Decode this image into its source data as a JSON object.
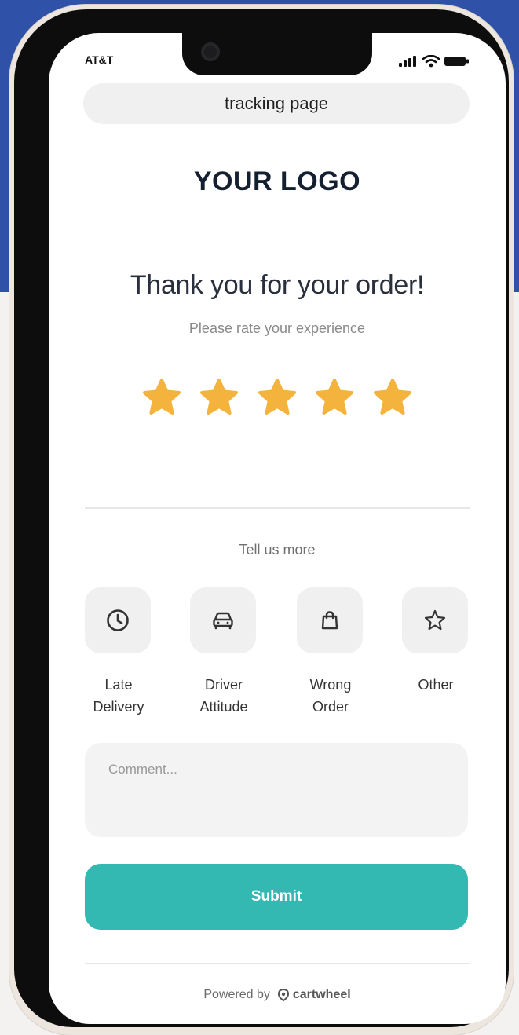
{
  "status_bar": {
    "carrier": "AT&T"
  },
  "browser": {
    "url_label": "tracking page"
  },
  "page": {
    "logo_text": "YOUR LOGO",
    "headline": "Thank you for your order!",
    "subline": "Please rate your experience",
    "rating": {
      "value": 5,
      "max": 5,
      "star_color": "#F3B33D"
    },
    "tell_us_more": "Tell us more",
    "reasons": [
      {
        "label": "Late\nDelivery",
        "icon": "clock-icon"
      },
      {
        "label": "Driver\nAttitude",
        "icon": "car-icon"
      },
      {
        "label": "Wrong\nOrder",
        "icon": "bag-icon"
      },
      {
        "label": "Other",
        "icon": "star-outline-icon"
      }
    ],
    "comment_placeholder": "Comment...",
    "submit_label": "Submit",
    "footer": {
      "powered_by": "Powered by",
      "brand": "cartwheel"
    }
  },
  "colors": {
    "background_top": "#2F52A8",
    "accent": "#33B8B2",
    "star": "#F3B33D",
    "text_dark": "#142030"
  }
}
